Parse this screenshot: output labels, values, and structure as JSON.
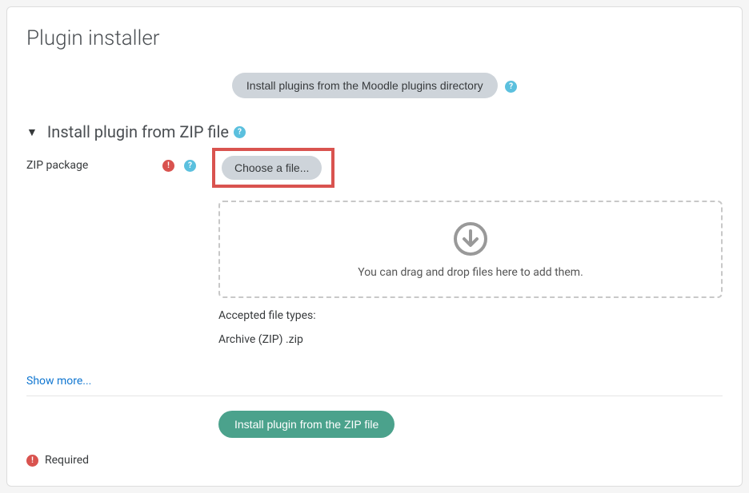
{
  "page": {
    "title": "Plugin installer"
  },
  "directory_button": {
    "label": "Install plugins from the Moodle plugins directory"
  },
  "section": {
    "title": "Install plugin from ZIP file"
  },
  "form": {
    "zip_label": "ZIP package",
    "choose_file_label": "Choose a file...",
    "dropzone_text": "You can drag and drop files here to add them.",
    "accepted_label": "Accepted file types:",
    "accepted_types": "Archive (ZIP) .zip",
    "show_more": "Show more...",
    "submit_label": "Install plugin from the ZIP file"
  },
  "legend": {
    "required": "Required"
  }
}
